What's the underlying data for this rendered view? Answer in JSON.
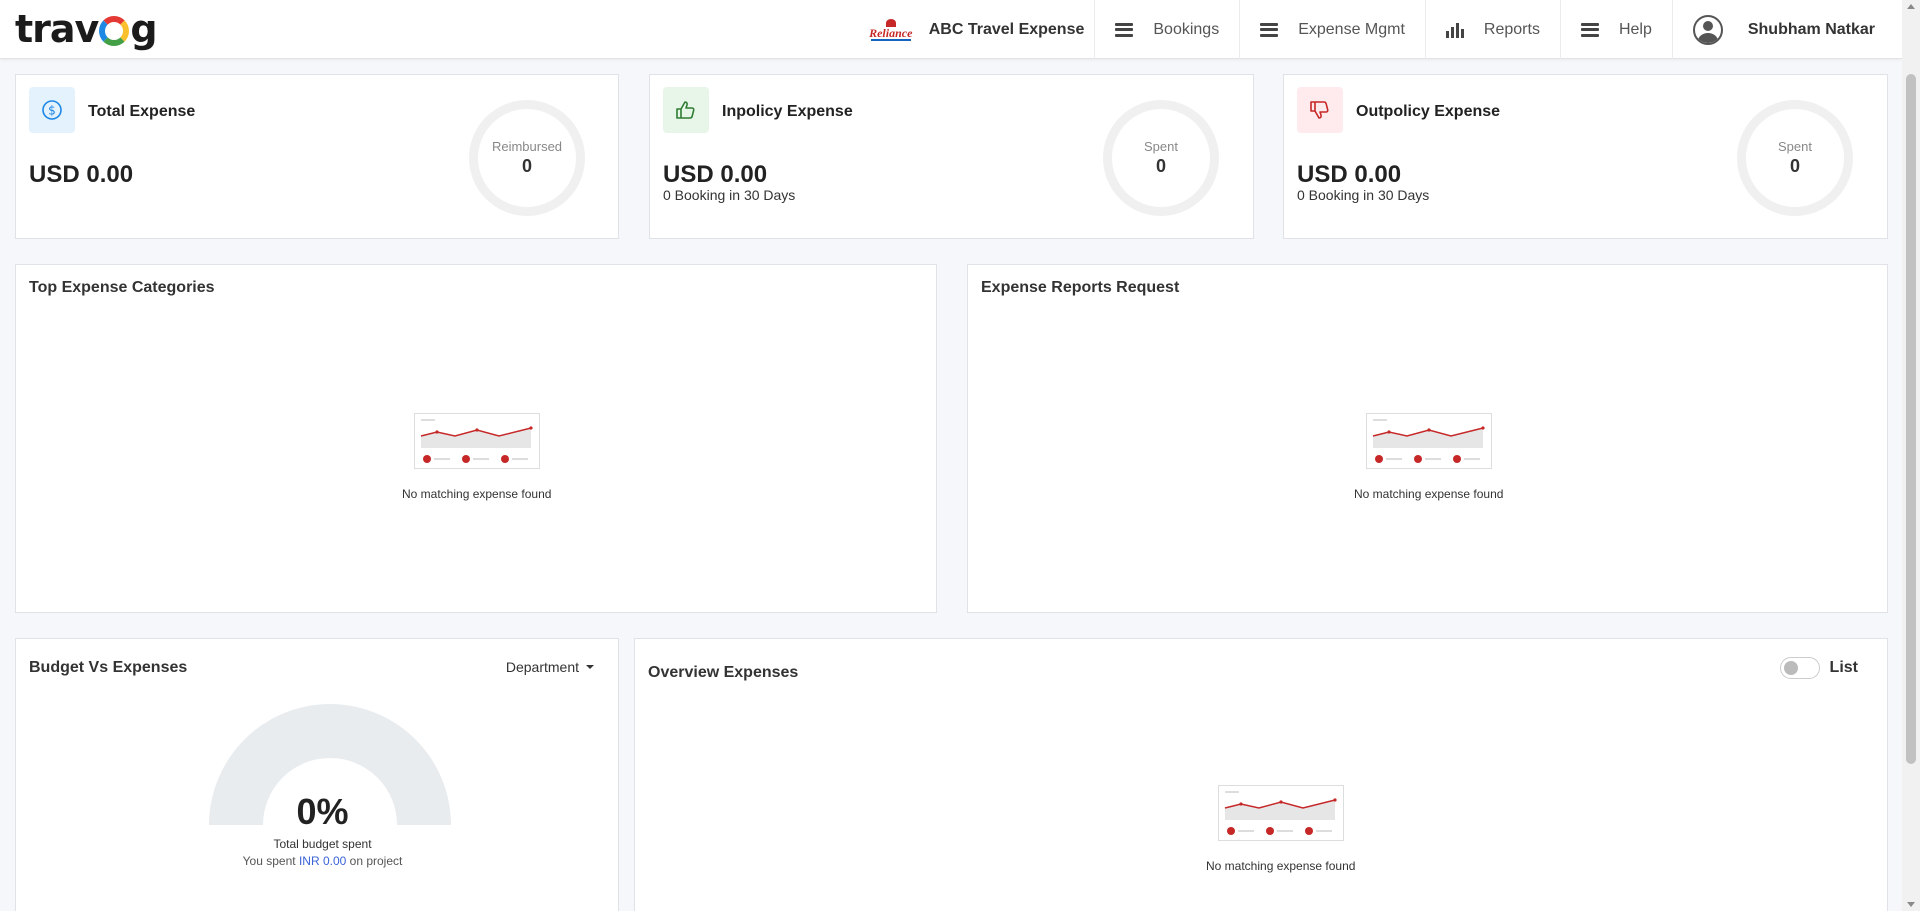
{
  "header": {
    "logo_text_before": "trav",
    "logo_text_after": "g",
    "company_logo_text": "Reliance",
    "company_name": "ABC Travel Expense",
    "nav": [
      {
        "label": "Bookings",
        "icon": "menu-icon"
      },
      {
        "label": "Expense Mgmt",
        "icon": "menu-icon"
      },
      {
        "label": "Reports",
        "icon": "bar-chart-icon"
      },
      {
        "label": "Help",
        "icon": "menu-icon"
      }
    ],
    "user_name": "Shubham Natkar"
  },
  "stats": [
    {
      "title": "Total Expense",
      "amount": "USD 0.00",
      "sub": "",
      "ring_label": "Reimbursed",
      "ring_value": "0",
      "icon": "dollar-icon",
      "icon_bg": "#e3f2fd",
      "icon_color": "#1e88e5"
    },
    {
      "title": "Inpolicy Expense",
      "amount": "USD 0.00",
      "sub": "0 Booking in 30 Days",
      "ring_label": "Spent",
      "ring_value": "0",
      "icon": "thumbs-up-icon",
      "icon_bg": "#e8f5e9",
      "icon_color": "#2e7d32"
    },
    {
      "title": "Outpolicy Expense",
      "amount": "USD 0.00",
      "sub": "0 Booking in 30 Days",
      "ring_label": "Spent",
      "ring_value": "0",
      "icon": "thumbs-down-icon",
      "icon_bg": "#ffebee",
      "icon_color": "#c62828"
    }
  ],
  "panels": {
    "top_categories": {
      "title": "Top Expense Categories",
      "empty": "No matching expense found"
    },
    "reports_request": {
      "title": "Expense Reports Request",
      "empty": "No matching expense found"
    },
    "budget": {
      "title": "Budget Vs Expenses",
      "dropdown": "Department",
      "percent": "0%",
      "percent_value": 0,
      "label": "Total budget spent",
      "spent_prefix": "You spent",
      "spent_amount": "INR 0.00",
      "spent_suffix": "on project"
    },
    "overview": {
      "title": "Overview Expenses",
      "toggle_label": "List",
      "toggle_on": false,
      "empty": "No matching expense found"
    }
  },
  "colors": {
    "accent_red": "#c62828",
    "link_blue": "#3a64d8"
  }
}
